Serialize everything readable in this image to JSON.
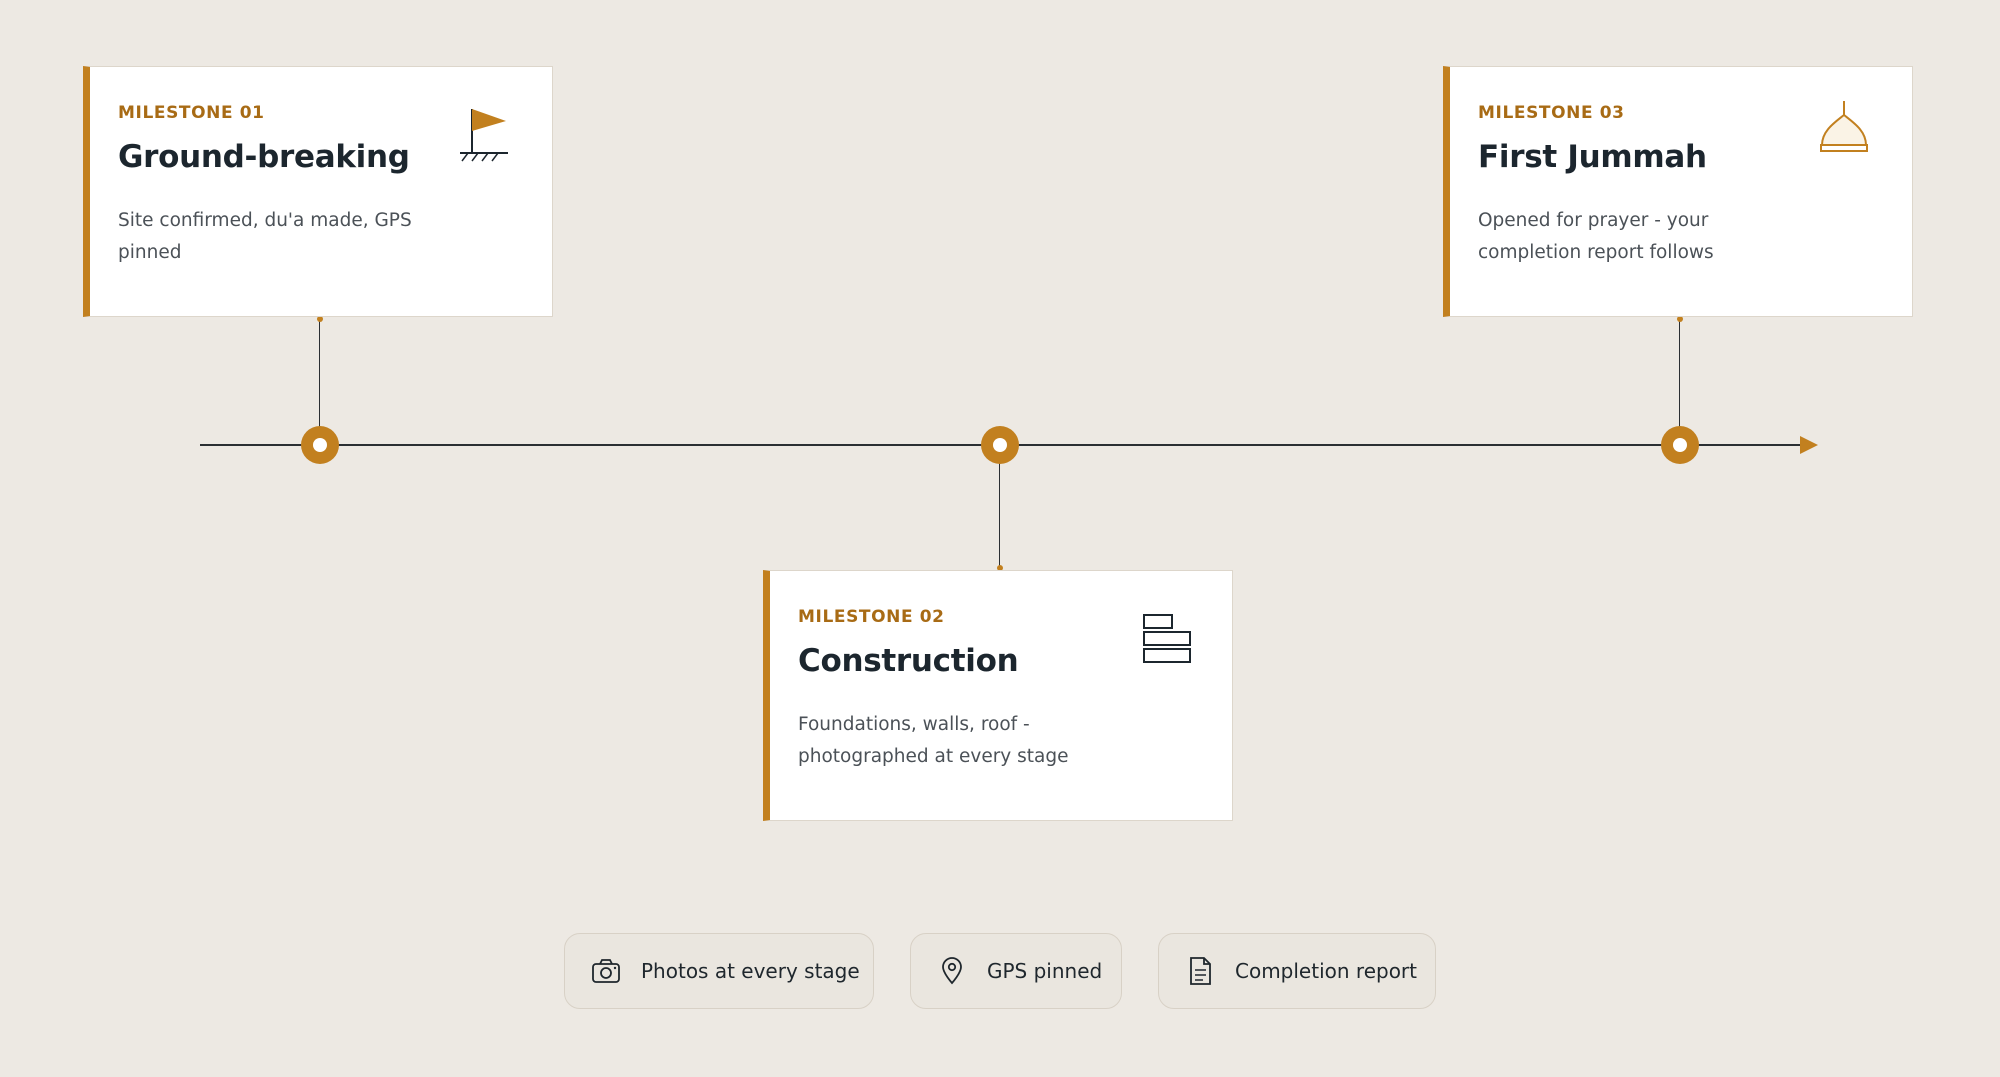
{
  "milestones": [
    {
      "eyebrow": "MILESTONE 01",
      "title": "Ground-breaking",
      "description": "Site confirmed, du'a made, GPS pinned",
      "icon": "flag-icon"
    },
    {
      "eyebrow": "MILESTONE 02",
      "title": "Construction",
      "description": "Foundations, walls, roof - photographed at every stage",
      "icon": "bricks-icon"
    },
    {
      "eyebrow": "MILESTONE 03",
      "title": "First Jummah",
      "description": "Opened for prayer - your completion report follows",
      "icon": "dome-icon"
    }
  ],
  "badges": [
    {
      "label": "Photos at every stage",
      "icon": "camera-icon"
    },
    {
      "label": "GPS pinned",
      "icon": "map-pin-icon"
    },
    {
      "label": "Completion report",
      "icon": "document-icon"
    }
  ],
  "colors": {
    "accent": "#c2801f",
    "background": "#ede9e3",
    "text_dark": "#1c262e",
    "line": "#2b2f33"
  }
}
